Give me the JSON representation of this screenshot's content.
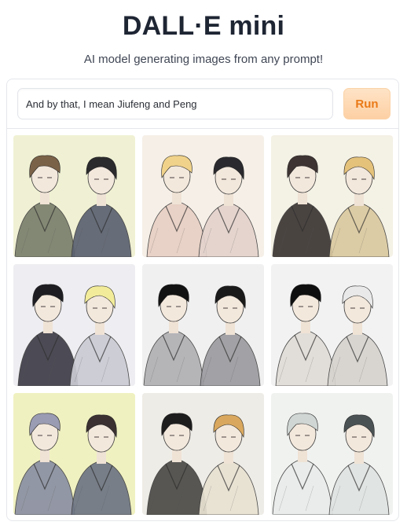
{
  "header": {
    "title": "DALL·E mini",
    "subtitle": "AI model generating images from any prompt!"
  },
  "prompt": {
    "value": "And by that, I mean Jiufeng and Peng"
  },
  "run_button": {
    "label": "Run"
  },
  "colors": {
    "accent": "#ea7a17",
    "button_bg": "#fdd9b5",
    "border": "#e5e7eb"
  },
  "gallery": {
    "images": [
      {
        "bg": "#eef0cf",
        "tone_a": "#7a7f6c",
        "tone_b": "#5b6170",
        "hair_a": "#7a6248",
        "hair_b": "#2b2a2c"
      },
      {
        "bg": "#f4ede4",
        "tone_a": "#e6cfc4",
        "tone_b": "#e3d2cc",
        "hair_a": "#f0d28a",
        "hair_b": "#2a2a2e"
      },
      {
        "bg": "#f3efe2",
        "tone_a": "#3b3634",
        "tone_b": "#d9c9a0",
        "hair_a": "#3e3433",
        "hair_b": "#e4c27a"
      },
      {
        "bg": "#ecebef",
        "tone_a": "#3e3d48",
        "tone_b": "#c9cad3",
        "hair_a": "#1e1d22",
        "hair_b": "#f2ec9a"
      },
      {
        "bg": "#eeeeee",
        "tone_a": "#b0b0b3",
        "tone_b": "#9c9ca0",
        "hair_a": "#121212",
        "hair_b": "#1a1a1a"
      },
      {
        "bg": "#f1f1f1",
        "tone_a": "#e0dcd6",
        "tone_b": "#d6d3cf",
        "hair_a": "#0f0f0f",
        "hair_b": "#e9e9e9"
      },
      {
        "bg": "#eef0b9",
        "tone_a": "#8b90a3",
        "tone_b": "#6d7584",
        "hair_a": "#9a9cb3",
        "hair_b": "#3b3132"
      },
      {
        "bg": "#eceae3",
        "tone_a": "#4b4a46",
        "tone_b": "#e8e2d2",
        "hair_a": "#1d1d1e",
        "hair_b": "#d9a85e"
      },
      {
        "bg": "#eef1ee",
        "tone_a": "#e9ecea",
        "tone_b": "#dfe3e1",
        "hair_a": "#cfd6d3",
        "hair_b": "#4a5254"
      }
    ]
  }
}
